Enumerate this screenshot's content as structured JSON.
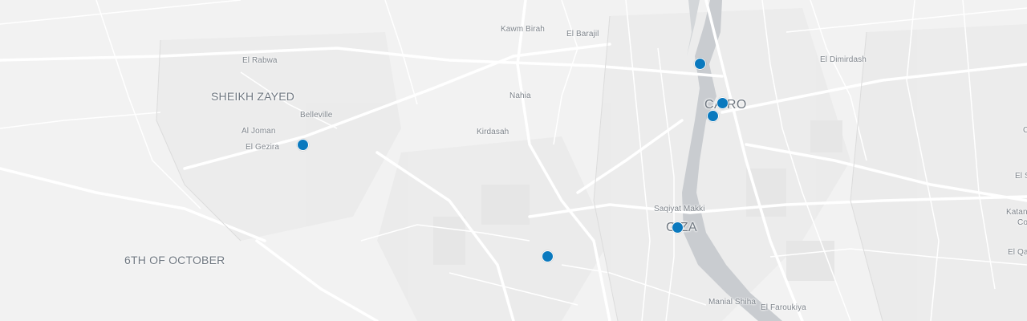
{
  "map": {
    "labels": {
      "kawm_birah": "Kawm Birah",
      "el_barajil": "El Barajil",
      "el_rabwa": "El Rabwa",
      "el_dimirdash": "El Dimirdash",
      "sheikh_zayed": "SHEIKH ZAYED",
      "nahia": "Nahia",
      "cairo": "CAIRO",
      "belleville": "Belleville",
      "kirdasah": "Kirdasah",
      "al_joman": "Al Joman",
      "el_gezira": "El Gezira",
      "saqiyat_makki": "Saqiyat Makki",
      "giza": "GIZA",
      "sixth_of_october": "6TH OF OCTOBER",
      "manial_shiha": "Manial Shiha",
      "el_faroukiya": "El Faroukiya",
      "edge_c": "C",
      "edge_el_s": "El S",
      "edge_katan": "Katan",
      "edge_co": "Co",
      "edge_el_qa": "El Qa"
    },
    "markers": [
      {
        "id": "marker-1"
      },
      {
        "id": "marker-2"
      },
      {
        "id": "marker-3"
      },
      {
        "id": "marker-4"
      },
      {
        "id": "marker-5"
      },
      {
        "id": "marker-6"
      }
    ],
    "colors": {
      "background": "#f2f2f2",
      "water": "#c9ccd0",
      "road": "#ffffff",
      "marker": "#0a79be",
      "label": "#7d838a"
    }
  }
}
